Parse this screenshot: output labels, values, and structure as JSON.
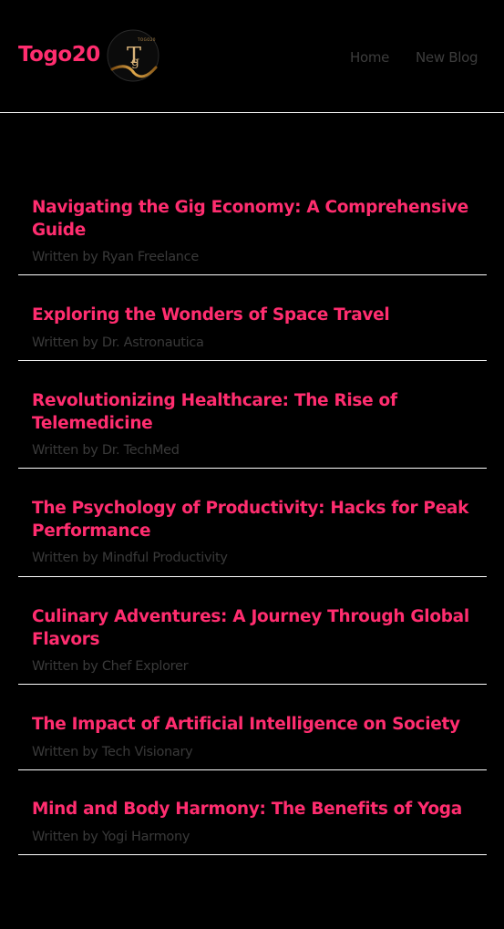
{
  "header": {
    "brand": "Togo20",
    "logo_text": "TOGO20",
    "nav": [
      {
        "label": "Home"
      },
      {
        "label": "New Blog"
      }
    ]
  },
  "colors": {
    "background": "#000000",
    "accent": "#ff2d6f",
    "muted_text": "#3a3a3a",
    "divider": "#ffffff"
  },
  "posts": [
    {
      "title": "Navigating the Gig Economy: A Comprehensive Guide",
      "author_line": "Written by Ryan Freelance"
    },
    {
      "title": "Exploring the Wonders of Space Travel",
      "author_line": "Written by Dr. Astronautica"
    },
    {
      "title": "Revolutionizing Healthcare: The Rise of Telemedicine",
      "author_line": "Written by Dr. TechMed"
    },
    {
      "title": "The Psychology of Productivity: Hacks for Peak Performance",
      "author_line": "Written by Mindful Productivity"
    },
    {
      "title": "Culinary Adventures: A Journey Through Global Flavors",
      "author_line": "Written by Chef Explorer"
    },
    {
      "title": "The Impact of Artificial Intelligence on Society",
      "author_line": "Written by Tech Visionary"
    },
    {
      "title": "Mind and Body Harmony: The Benefits of Yoga",
      "author_line": "Written by Yogi Harmony"
    }
  ]
}
